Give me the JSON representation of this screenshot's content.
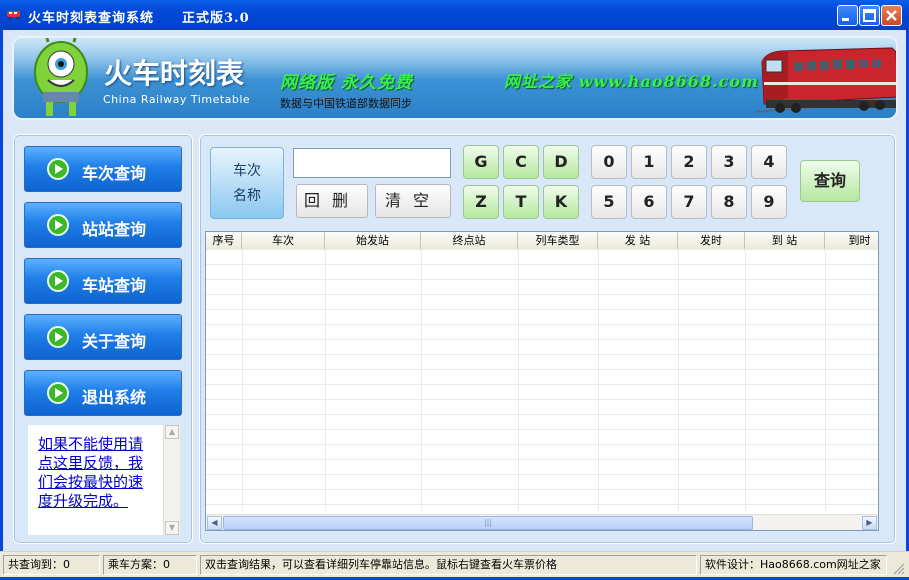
{
  "window": {
    "title": "火车时刻表查询系统　　正式版3.0"
  },
  "banner": {
    "title": "火车时刻表",
    "subtitle": "China Railway Timetable",
    "slogan": "网络版 永久免费",
    "sync_text": "数据与中国铁道部数据同步",
    "site": "网址之家 www.hao8668.com"
  },
  "nav": {
    "items": [
      {
        "label": "车次查询"
      },
      {
        "label": "站站查询"
      },
      {
        "label": "车站查询"
      },
      {
        "label": "关于查询"
      },
      {
        "label": "退出系统"
      }
    ]
  },
  "feedback": {
    "link": "如果不能使用请点这里反馈，我们会按最快的速度升级完成。"
  },
  "search": {
    "mode_line1": "车次",
    "mode_line2": "名称",
    "input_value": "",
    "backspace_label": "回删",
    "clear_label": "清空",
    "query_label": "查询",
    "letter_keys": [
      "G",
      "C",
      "D",
      "Z",
      "T",
      "K"
    ],
    "number_keys": [
      "0",
      "1",
      "2",
      "3",
      "4",
      "5",
      "6",
      "7",
      "8",
      "9"
    ]
  },
  "table": {
    "columns": [
      "序号",
      "车次",
      "始发站",
      "终点站",
      "列车类型",
      "发 站",
      "发时",
      "到 站",
      "到时"
    ],
    "rows": []
  },
  "status": {
    "total": "共查询到：0",
    "plans": "乘车方案：0",
    "hint": "双击查询结果，可以查看详细列车停靠站信息。鼠标右键查看火车票价格",
    "credit": "软件设计：Hao8668.com网址之家"
  },
  "colors": {
    "title_bar": "#0148d6",
    "nav_button": "#1f7ee8",
    "key_green": "#b6e79f",
    "slogan_green": "#38f04a",
    "link": "#0000cc"
  }
}
